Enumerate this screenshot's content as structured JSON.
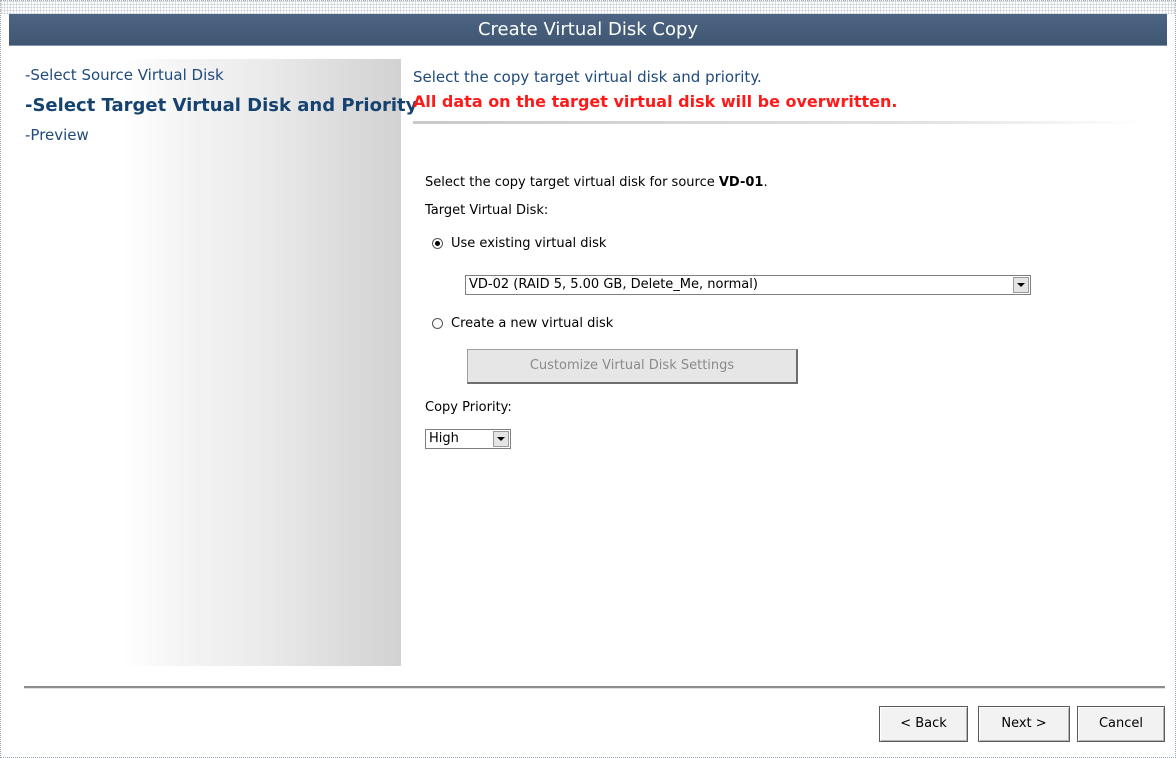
{
  "window": {
    "title": "Create Virtual Disk Copy"
  },
  "sidebar": {
    "items": [
      {
        "label": "-Select Source Virtual Disk"
      },
      {
        "label": "-Select Target Virtual Disk and Priority"
      },
      {
        "label": "-Preview"
      }
    ]
  },
  "header": {
    "instruction": "Select the copy target virtual disk and priority.",
    "warning": "All data on the target virtual disk will be overwritten."
  },
  "form": {
    "source_prefix": "Select the copy target virtual disk for source ",
    "source_name": "VD-01",
    "source_suffix": ".",
    "target_label": "Target Virtual Disk:",
    "use_existing_label": "Use existing virtual disk",
    "existing_selected": "VD-02 (RAID 5, 5.00 GB, Delete_Me, normal)",
    "create_new_label": "Create a new virtual disk",
    "customize_label": "Customize Virtual Disk Settings",
    "priority_label": "Copy Priority:",
    "priority_selected": "High"
  },
  "footer": {
    "back_label": "< Back",
    "next_label": "Next >",
    "cancel_label": "Cancel"
  }
}
